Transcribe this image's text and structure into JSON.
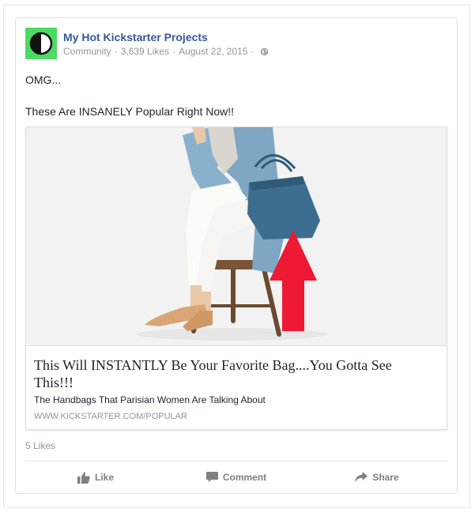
{
  "post": {
    "page_name": "My Hot Kickstarter Projects",
    "category": "Community",
    "likes_meta": "3,639 Likes",
    "date": "August 22, 2015",
    "text_line1": "OMG...",
    "text_line2": "These Are INSANELY Popular Right Now!!"
  },
  "link_preview": {
    "title": "This Will INSTANTLY Be Your Favorite Bag....You Gotta See This!!!",
    "description": "The Handbags That Parisian Women Are Talking About",
    "domain": "WWW.KICKSTARTER.COM/POPULAR"
  },
  "footer": {
    "likes": "5 Likes",
    "like_label": "Like",
    "comment_label": "Comment",
    "share_label": "Share"
  },
  "colors": {
    "link_blue": "#365899",
    "avatar_green": "#4cd964",
    "arrow_red": "#ee1a33",
    "bag_blue": "#3d6e8f"
  },
  "icons": [
    "half-circle-logo-icon",
    "globe-icon",
    "thumbs-up-icon",
    "comment-icon",
    "share-arrow-icon"
  ]
}
